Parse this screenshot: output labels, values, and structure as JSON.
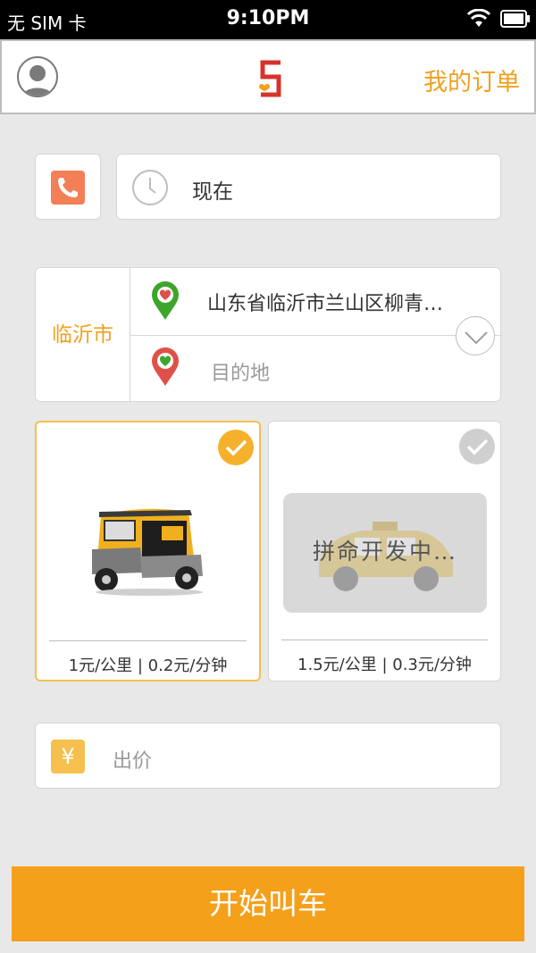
{
  "status_bar": {
    "carrier": "无 SIM 卡",
    "time": "9:10PM"
  },
  "header": {
    "my_orders": "我的订单",
    "logo_icon": "s-logo-icon",
    "avatar_icon": "user-avatar-icon"
  },
  "time_row": {
    "phone_icon": "phone-icon",
    "clock_icon": "clock-icon",
    "value": "现在"
  },
  "route": {
    "city": "临沂市",
    "origin": "山东省临沂市兰山区柳青…",
    "destination_placeholder": "目的地"
  },
  "vehicles": [
    {
      "price": "1元/公里 | 0.2元/分钟",
      "selected": true
    },
    {
      "price": "1.5元/公里 | 0.3元/分钟",
      "selected": false,
      "overlay": "拼命开发中…"
    }
  ],
  "bid": {
    "currency_symbol": "¥",
    "placeholder": "出价"
  },
  "call_button": "开始叫车",
  "colors": {
    "accent": "#f5a01a",
    "phone": "#f37f56",
    "origin_pin": "#3ea52b",
    "dest_pin": "#e0504a"
  }
}
